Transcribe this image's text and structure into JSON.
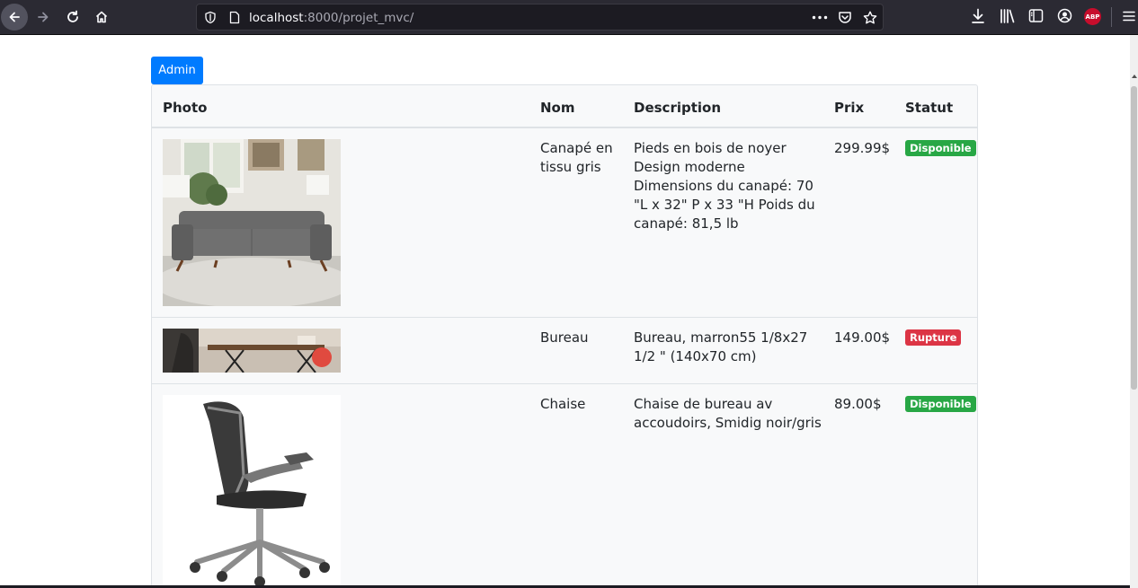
{
  "browser": {
    "url_host": "localhost",
    "url_rest": ":8000/projet_mvc/",
    "extension_badge": "ABP"
  },
  "page": {
    "admin_button": "Admin",
    "table": {
      "headers": [
        "Photo",
        "Nom",
        "Description",
        "Prix",
        "Statut"
      ],
      "rows": [
        {
          "name": "Canapé en tissu gris",
          "description": "Pieds en bois de noyer Design moderne Dimensions du canapé: 70 \"L x 32\" P x 33 \"H Poids du canapé: 81,5 lb",
          "price": "299.99$",
          "status": "Disponible",
          "status_color": "#28a745"
        },
        {
          "name": "Bureau",
          "description": "Bureau, marron55 1/8x27 1/2 \" (140x70 cm)",
          "price": "149.00$",
          "status": "Rupture",
          "status_color": "#dc3545"
        },
        {
          "name": "Chaise",
          "description": "Chaise de bureau av accoudoirs, Smidig noir/gris",
          "price": "89.00$",
          "status": "Disponible",
          "status_color": "#28a745"
        }
      ]
    }
  }
}
